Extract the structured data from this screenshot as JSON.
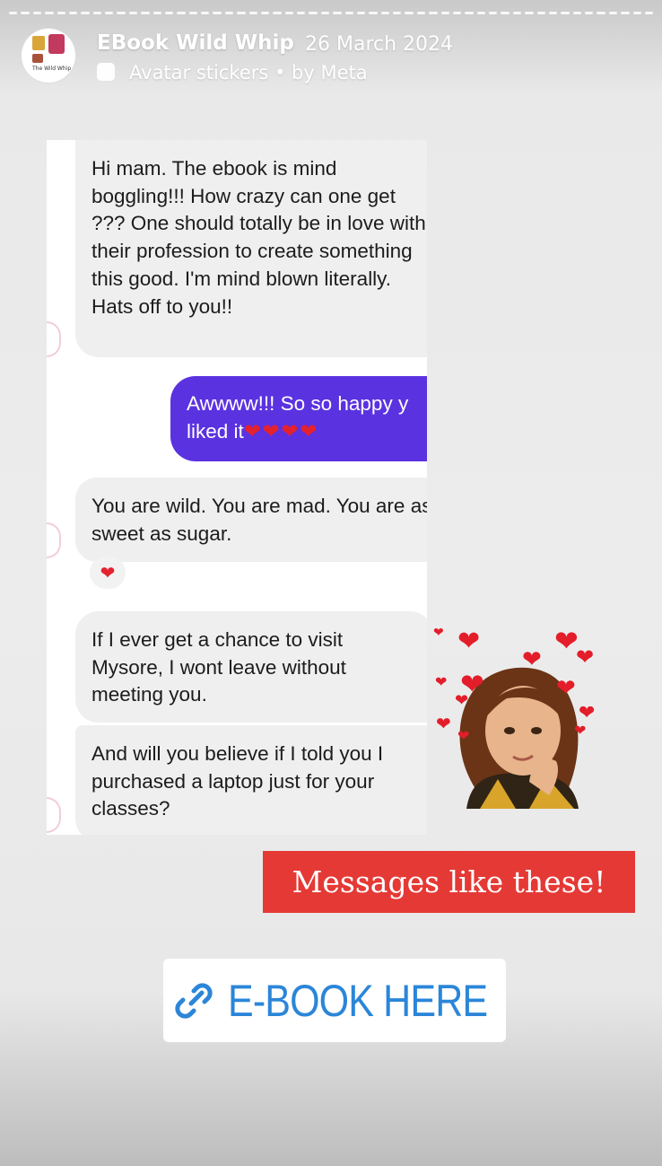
{
  "header": {
    "account_name": "EBook Wild Whip",
    "date": "26 March 2024",
    "subtitle": "Avatar stickers • by Meta",
    "avatar_text": "The Wild Whip"
  },
  "chat": {
    "messages": [
      {
        "from": "them",
        "text": "Hi mam. The ebook is mind boggling!!! How crazy can one get ??? One should totally be in love with their profession to create something this good. I'm mind blown literally. Hats off to you!!"
      },
      {
        "from": "me",
        "text": "Awwww!!! So so happy y",
        "text2": "liked it",
        "hearts": "❤❤❤❤"
      },
      {
        "from": "them",
        "text": "You are wild. You are mad. You are as sweet as sugar.",
        "reaction": "❤"
      },
      {
        "from": "them",
        "text": "If I ever get a chance to visit Mysore, I wont leave without meeting you."
      },
      {
        "from": "them",
        "text": "And will you believe if I told you I purchased a laptop just for your classes?"
      }
    ]
  },
  "caption": "Messages like these!",
  "link_sticker": {
    "label": "E-BOOK HERE",
    "icon": "link-icon"
  },
  "colors": {
    "accent_red": "#e53935",
    "link_blue": "#2b86d8",
    "outgoing_bubble": "#5b32e0"
  }
}
